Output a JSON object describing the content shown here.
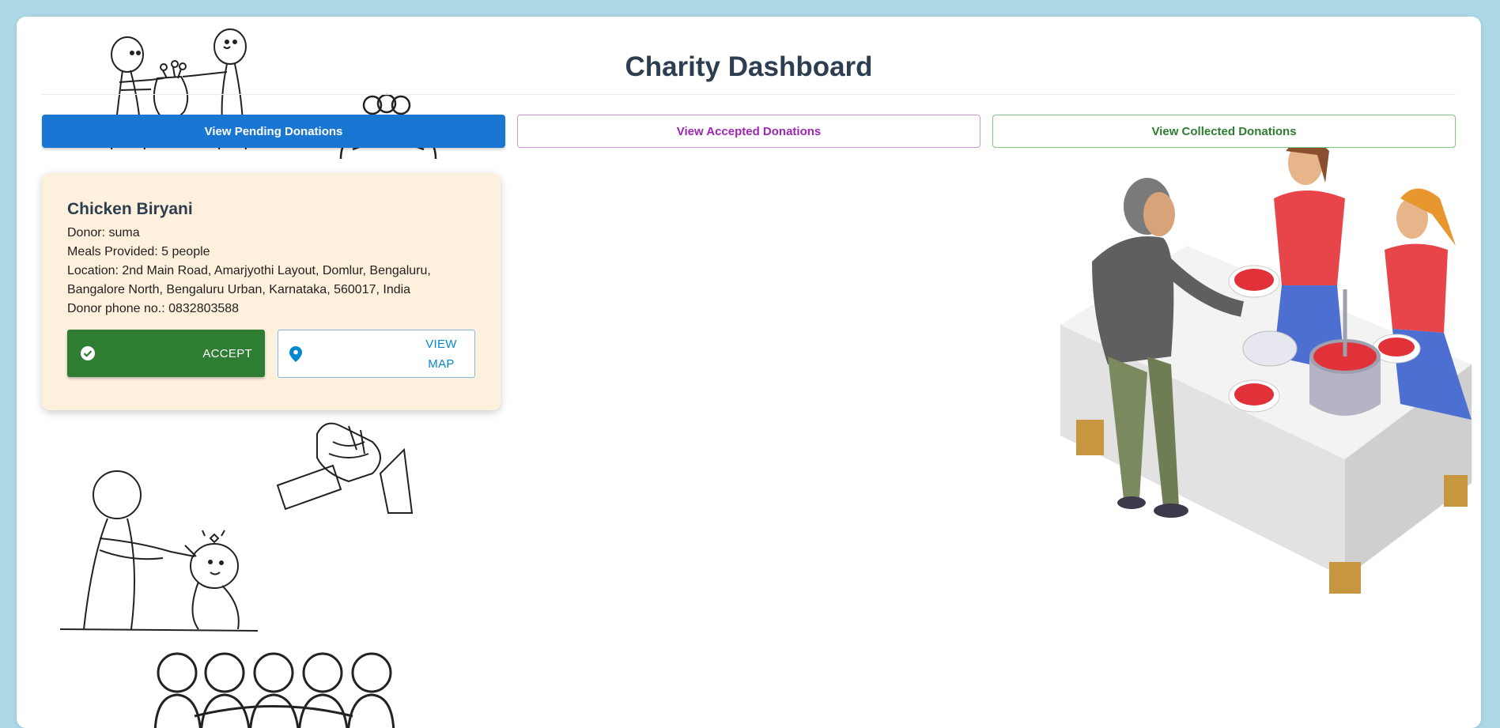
{
  "header": {
    "title": "Charity Dashboard"
  },
  "tabs": {
    "pending_label": "View Pending Donations",
    "accepted_label": "View Accepted Donations",
    "collected_label": "View Collected Donations"
  },
  "donation": {
    "food_name": "Chicken Biryani",
    "donor_line": "Donor: suma",
    "meals_line": "Meals Provided: 5 people",
    "location_line": "Location: 2nd Main Road, Amarjyothi Layout, Domlur, Bengaluru, Bangalore North, Bengaluru Urban, Karnataka, 560017, India",
    "phone_line": "Donor phone no.: 0832803588",
    "accept_label": "ACCEPT",
    "map_label": "VIEW MAP"
  },
  "colors": {
    "background": "#add8e6",
    "primary": "#1976d2",
    "secondary": "#9c27b0",
    "success": "#2e7d32",
    "card": "#fdf0dc",
    "info": "#0288d1"
  },
  "icons": {
    "accept": "check-circle-icon",
    "map": "location-pin-icon"
  }
}
